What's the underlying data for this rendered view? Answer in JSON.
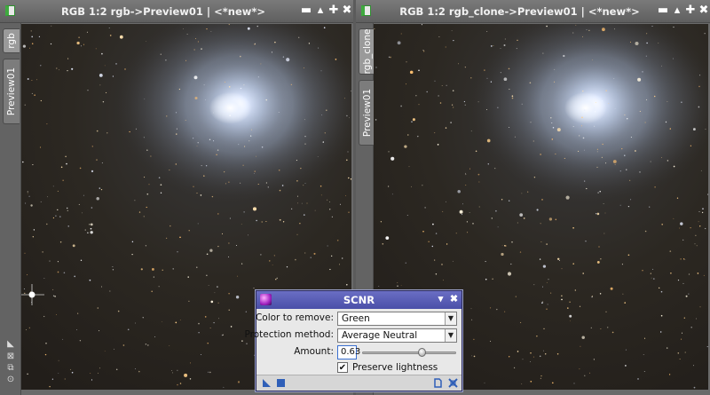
{
  "windows": [
    {
      "title": "RGB 1:2 rgb->Preview01 | <*new*>",
      "tabs": [
        "rgb",
        "Preview01"
      ],
      "buttons": [
        "minimize",
        "shade",
        "maximize",
        "close"
      ]
    },
    {
      "title": "RGB 1:2 rgb_clone->Preview01 | <*new*>",
      "tabs": [
        "rgb_clone",
        "Preview01"
      ],
      "buttons": [
        "minimize",
        "shade",
        "maximize",
        "close"
      ]
    }
  ],
  "dialog": {
    "title": "SCNR",
    "color_to_remove": {
      "label": "Color to remove:",
      "value": "Green"
    },
    "protection_method": {
      "label": "Protection method:",
      "value": "Average Neutral"
    },
    "amount": {
      "label": "Amount:",
      "value": "0.63",
      "fraction": 0.63
    },
    "preserve_lightness": {
      "label": "Preserve lightness",
      "checked": true
    }
  },
  "icons": {
    "title_min": "▬",
    "title_shade": "▴",
    "title_max": "✚",
    "title_close": "✖",
    "dialog_shade": "▾",
    "dialog_close": "✖",
    "check": "✔",
    "dropdown": "▼"
  },
  "colors": {
    "dialog_titlebar": "#5a5fb8",
    "window_titlebar": "#6c6c6c",
    "nebula": "#cfe0ff",
    "background_sky": "#2a2620"
  }
}
